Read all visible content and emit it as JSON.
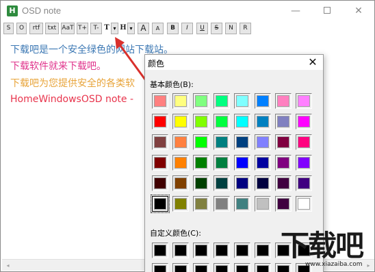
{
  "window": {
    "title": "OSD note",
    "icon_letter": "H",
    "minimize_glyph": "—",
    "close_glyph": "✕"
  },
  "toolbar": {
    "buttons": [
      "S",
      "O",
      "rtf",
      "txt",
      "AaT",
      "T+",
      "T-",
      "T",
      "H",
      "A",
      "A",
      "B",
      "I",
      "U",
      "S",
      "N",
      "R"
    ],
    "dropdown_glyph": "▾"
  },
  "editor": {
    "lines": [
      {
        "text": "下载吧是一个安全绿色的网站下载站。",
        "color": "#3c78b4"
      },
      {
        "text": "下载软件就来下载吧。",
        "color": "#e0348c"
      },
      {
        "text": "下载吧为您提供安全的各类软",
        "color": "#e8a43a"
      },
      {
        "text": "HomeWindowsOSD note -",
        "color": "#e8344c"
      }
    ]
  },
  "scrollbar": {
    "left_glyph": "◂",
    "right_glyph": "▸"
  },
  "color_dialog": {
    "title": "颜色",
    "close_glyph": "✕",
    "basic_label": "基本颜色(B):",
    "custom_label": "自定义颜色(C):",
    "basic_colors": [
      [
        "#ff8080",
        "#ffff80",
        "#80ff80",
        "#00ff80",
        "#80ffff",
        "#0080ff",
        "#ff80c0",
        "#ff80ff"
      ],
      [
        "#ff0000",
        "#ffff00",
        "#80ff00",
        "#00ff40",
        "#00ffff",
        "#0080c0",
        "#8080c0",
        "#ff00ff"
      ],
      [
        "#804040",
        "#ff8040",
        "#00ff00",
        "#008080",
        "#004080",
        "#8080ff",
        "#800040",
        "#ff0080"
      ],
      [
        "#800000",
        "#ff8000",
        "#008000",
        "#008040",
        "#0000ff",
        "#0000a0",
        "#800080",
        "#8000ff"
      ],
      [
        "#400000",
        "#804000",
        "#004000",
        "#004040",
        "#000080",
        "#000040",
        "#400040",
        "#400080"
      ],
      [
        "#000000",
        "#808000",
        "#808040",
        "#808080",
        "#408080",
        "#c0c0c0",
        "#400040",
        "#ffffff"
      ]
    ],
    "selected_basic": "black",
    "custom_colors": [
      [
        "#000000",
        "#000000",
        "#000000",
        "#000000",
        "#000000",
        "#000000",
        "#000000",
        "#000000"
      ],
      [
        "#000000",
        "#000000",
        "#000000",
        "#000000",
        "#000000",
        "#000000",
        "#000000",
        "#000000"
      ]
    ]
  },
  "watermark": {
    "text": "下载吧",
    "url": "www.xiazaiba.com"
  }
}
